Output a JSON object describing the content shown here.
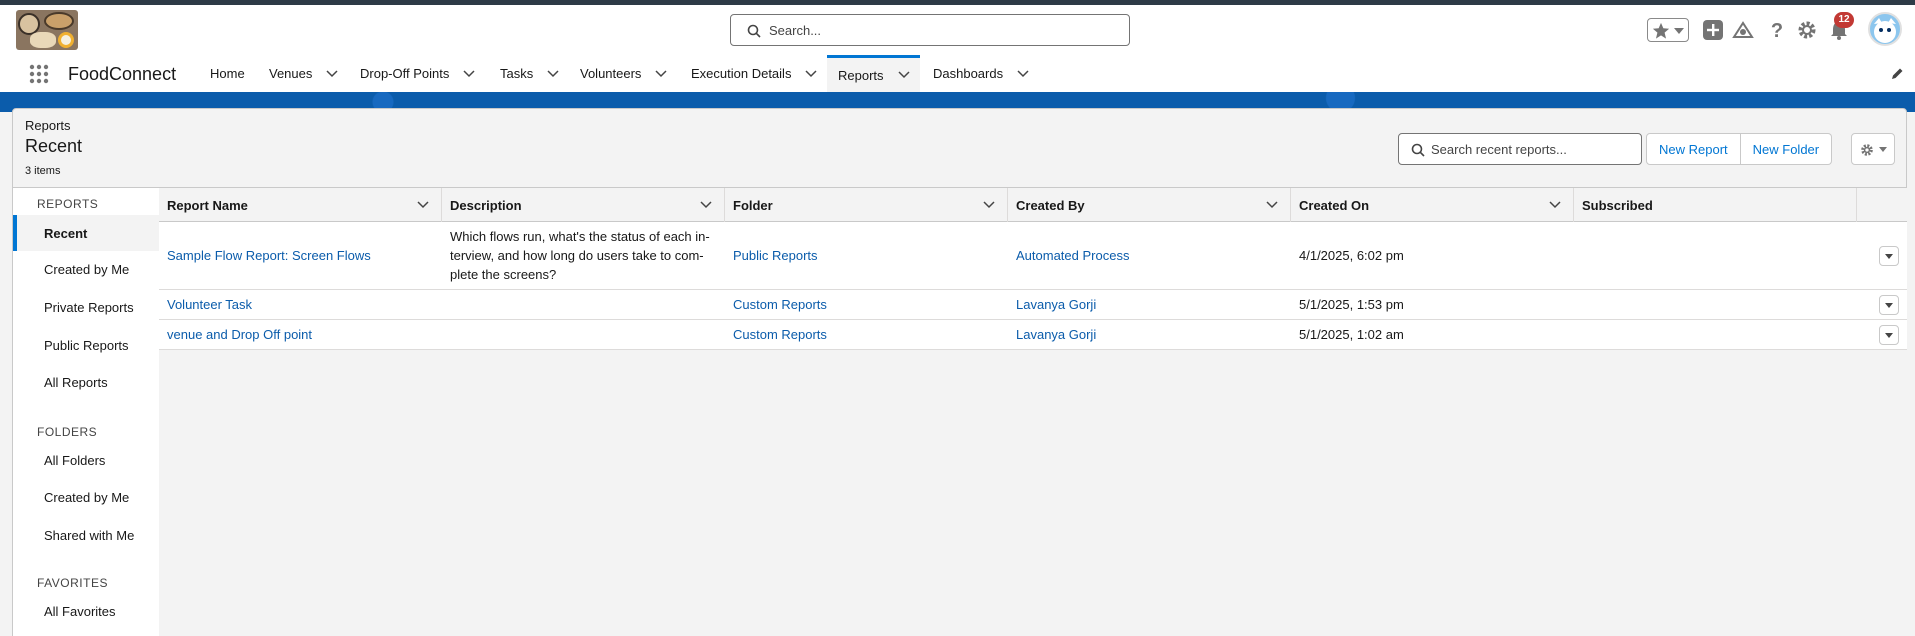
{
  "app": {
    "name": "FoodConnect",
    "global_search_placeholder": "Search...",
    "notification_count": "12"
  },
  "nav": {
    "items": [
      {
        "label": "Home"
      },
      {
        "label": "Venues"
      },
      {
        "label": "Drop-Off Points"
      },
      {
        "label": "Tasks"
      },
      {
        "label": "Volunteers"
      },
      {
        "label": "Execution Details"
      },
      {
        "label": "Reports"
      },
      {
        "label": "Dashboards"
      }
    ],
    "active": "Reports"
  },
  "page": {
    "breadcrumb": "Reports",
    "title": "Recent",
    "count": "3 items",
    "search_placeholder": "Search recent reports...",
    "new_report_label": "New Report",
    "new_folder_label": "New Folder"
  },
  "sidebar": {
    "reports_heading": "REPORTS",
    "reports_items": [
      "Recent",
      "Created by Me",
      "Private Reports",
      "Public Reports",
      "All Reports"
    ],
    "folders_heading": "FOLDERS",
    "folders_items": [
      "All Folders",
      "Created by Me",
      "Shared with Me"
    ],
    "favorites_heading": "FAVORITES",
    "favorites_items": [
      "All Favorites"
    ],
    "selected": "Recent"
  },
  "table": {
    "columns": [
      "Report Name",
      "Description",
      "Folder",
      "Created By",
      "Created On",
      "Subscribed"
    ],
    "rows": [
      {
        "name": "Sample Flow Report: Screen Flows",
        "description_lines": [
          "Which flows run, what's the status of each in-",
          "terview, and how long do users take to com-",
          "plete the screens?"
        ],
        "folder": "Public Reports",
        "created_by": "Automated Process",
        "created_on": "4/1/2025, 6:02 pm",
        "subscribed": ""
      },
      {
        "name": "Volunteer Task",
        "description_lines": [],
        "folder": "Custom Reports",
        "created_by": "Lavanya Gorji",
        "created_on": "5/1/2025, 1:53 pm",
        "subscribed": ""
      },
      {
        "name": "venue and Drop Off point",
        "description_lines": [],
        "folder": "Custom Reports",
        "created_by": "Lavanya Gorji",
        "created_on": "5/1/2025, 1:02 am",
        "subscribed": ""
      }
    ]
  },
  "colors": {
    "link": "#0b5cab",
    "brand": "#0176d3",
    "banner": "#0b5cab",
    "badge": "#c23934"
  }
}
